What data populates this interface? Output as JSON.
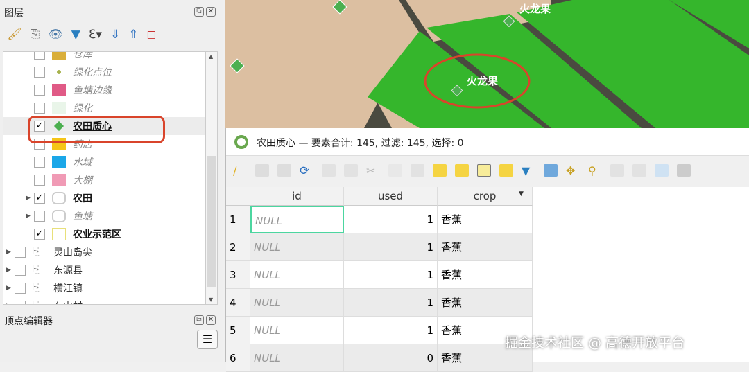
{
  "layers_panel": {
    "title": "图层",
    "float_icon": "⧉",
    "close_icon": "✕",
    "items": [
      {
        "label": "仓库",
        "checked": false,
        "color": "#d9ae3a",
        "style": "dim"
      },
      {
        "label": "绿化点位",
        "checked": false,
        "color": "#a7b24d",
        "style": "dim"
      },
      {
        "label": "鱼塘边缘",
        "checked": false,
        "color": "#e05a86",
        "style": "dim"
      },
      {
        "label": "绿化",
        "checked": false,
        "color": "#e9f5e9",
        "style": "dim"
      },
      {
        "label": "农田质心",
        "checked": true,
        "color": "#4caf50",
        "style": "bold"
      },
      {
        "label": "药店",
        "checked": false,
        "color": "#f5c518",
        "style": "dim"
      },
      {
        "label": "水域",
        "checked": false,
        "color": "#1ba7e8",
        "style": "dim"
      },
      {
        "label": "大棚",
        "checked": false,
        "color": "#f09ab5",
        "style": "dim"
      },
      {
        "label": "农田",
        "checked": true,
        "style": "bold"
      },
      {
        "label": "鱼塘",
        "checked": false,
        "style": "dim"
      },
      {
        "label": "农业示范区",
        "checked": true,
        "style": "bold"
      },
      {
        "label": "灵山岛尖",
        "checked": false,
        "style": "group"
      },
      {
        "label": "东源县",
        "checked": false,
        "style": "group"
      },
      {
        "label": "横江镇",
        "checked": false,
        "style": "group"
      },
      {
        "label": "东山村",
        "checked": false,
        "style": "group"
      }
    ]
  },
  "vertex_panel": {
    "title": "顶点编辑器",
    "menu_icon": "☰"
  },
  "map": {
    "labels": [
      "火龙果",
      "火龙果"
    ],
    "highlight": "#d9442b",
    "field_color": "#35b62c"
  },
  "attribute_table": {
    "title": "农田质心 — 要素合计: 145, 过滤: 145, 选择: 0",
    "columns": [
      "id",
      "used",
      "crop"
    ],
    "rows": [
      {
        "n": "1",
        "id": "NULL",
        "used": "1",
        "crop": "香蕉"
      },
      {
        "n": "2",
        "id": "NULL",
        "used": "1",
        "crop": "香蕉"
      },
      {
        "n": "3",
        "id": "NULL",
        "used": "1",
        "crop": "香蕉"
      },
      {
        "n": "4",
        "id": "NULL",
        "used": "1",
        "crop": "香蕉"
      },
      {
        "n": "5",
        "id": "NULL",
        "used": "1",
        "crop": "香蕉"
      },
      {
        "n": "6",
        "id": "NULL",
        "used": "0",
        "crop": "香蕉"
      }
    ]
  },
  "watermark": "掘金技术社区 @ 高德开放平台"
}
